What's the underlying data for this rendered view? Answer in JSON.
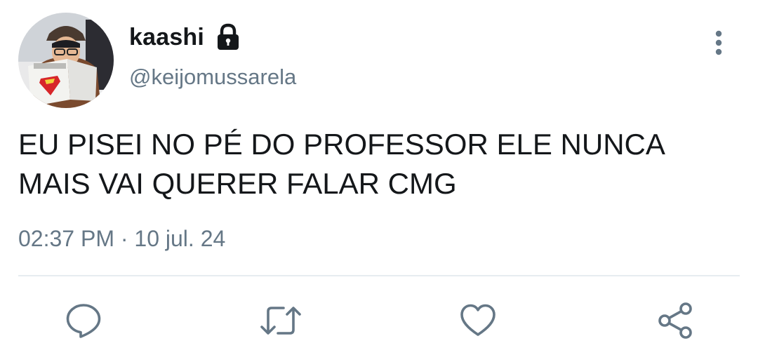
{
  "author": {
    "display_name": "kaashi",
    "handle": "@keijomussarela",
    "protected": true
  },
  "tweet": {
    "text": "EU PISEI NO PÉ DO PROFESSOR ELE NUNCA MAIS VAI QUERER FALAR CMG",
    "timestamp": "02:37 PM · 10 jul. 24"
  },
  "actions": [
    {
      "icon": "reply-icon"
    },
    {
      "icon": "retweet-icon"
    },
    {
      "icon": "like-icon"
    },
    {
      "icon": "share-icon"
    }
  ],
  "colors": {
    "text_primary": "#14171a",
    "text_secondary": "#657786",
    "icon": "#657786",
    "divider": "#e6ecf0"
  }
}
